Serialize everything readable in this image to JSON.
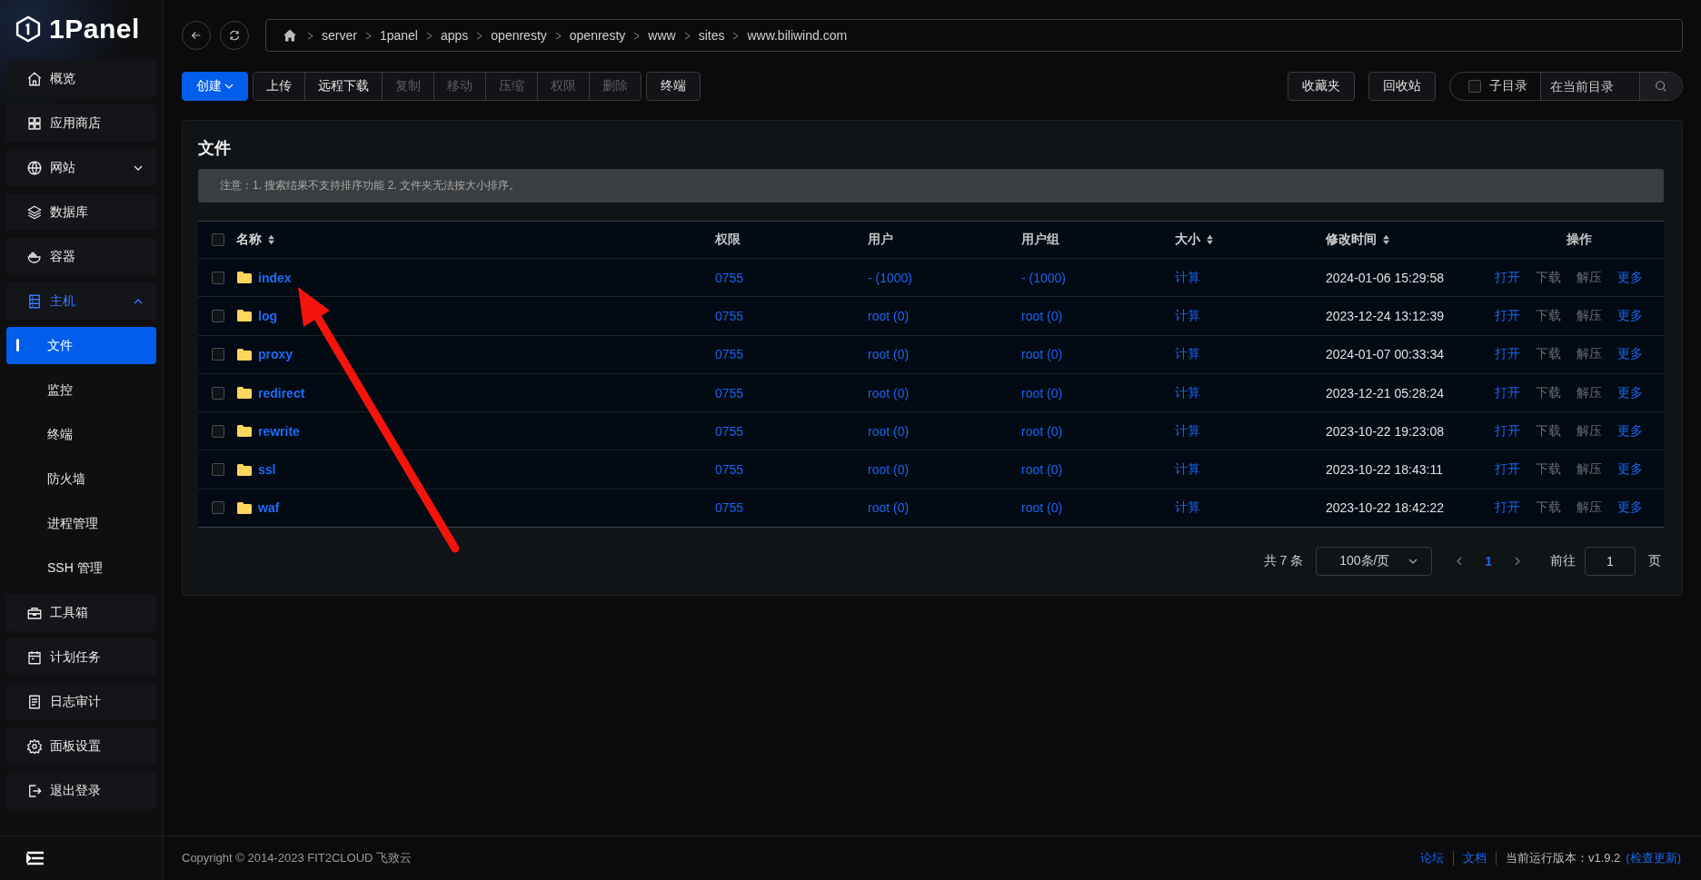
{
  "logo": {
    "text": "1Panel"
  },
  "sidebar": {
    "items": [
      {
        "label": "概览",
        "selected": false
      },
      {
        "label": "应用商店",
        "selected": false
      },
      {
        "label": "网站",
        "selected": false,
        "expanded": false
      },
      {
        "label": "数据库",
        "selected": false
      },
      {
        "label": "容器",
        "selected": false
      },
      {
        "label": "主机",
        "selected": false,
        "expanded": true,
        "children": [
          {
            "label": "文件",
            "selected": true
          },
          {
            "label": "监控",
            "selected": false
          },
          {
            "label": "终端",
            "selected": false
          },
          {
            "label": "防火墙",
            "selected": false
          },
          {
            "label": "进程管理",
            "selected": false
          },
          {
            "label": "SSH 管理",
            "selected": false
          }
        ]
      },
      {
        "label": "工具箱",
        "selected": false
      },
      {
        "label": "计划任务",
        "selected": false
      },
      {
        "label": "日志审计",
        "selected": false
      },
      {
        "label": "面板设置",
        "selected": false
      },
      {
        "label": "退出登录",
        "selected": false
      }
    ]
  },
  "breadcrumb": [
    "server",
    "1panel",
    "apps",
    "openresty",
    "openresty",
    "www",
    "sites",
    "www.biliwind.com"
  ],
  "toolbar": {
    "create": "创建",
    "actions": [
      {
        "label": "上传",
        "disabled": false
      },
      {
        "label": "远程下载",
        "disabled": false
      },
      {
        "label": "复制",
        "disabled": true
      },
      {
        "label": "移动",
        "disabled": true
      },
      {
        "label": "压缩",
        "disabled": true
      },
      {
        "label": "权限",
        "disabled": true
      },
      {
        "label": "删除",
        "disabled": true
      }
    ],
    "terminal": "终端",
    "favorites": "收藏夹",
    "recycle_bin": "回收站",
    "search": {
      "subdir_label": "子目录",
      "subdir_checked": false,
      "placeholder": "在当前目录"
    }
  },
  "card": {
    "title": "文件",
    "notice": "注意：1. 搜索结果不支持排序功能 2. 文件夹无法按大小排序。"
  },
  "table": {
    "all_checked": false,
    "columns": [
      {
        "label": "名称",
        "sortable": true
      },
      {
        "label": "权限",
        "sortable": false
      },
      {
        "label": "用户",
        "sortable": false
      },
      {
        "label": "用户组",
        "sortable": false
      },
      {
        "label": "大小",
        "sortable": true
      },
      {
        "label": "修改时间",
        "sortable": true
      },
      {
        "label": "操作",
        "sortable": false
      }
    ],
    "rows": [
      {
        "checked": false,
        "name": "index",
        "mode": "0755",
        "user": "- (1000)",
        "group": "- (1000)",
        "size": "计算",
        "modified": "2024-01-06 15:29:58",
        "actions": [
          {
            "label": "打开",
            "disabled": false
          },
          {
            "label": "下载",
            "disabled": true
          },
          {
            "label": "解压",
            "disabled": true
          },
          {
            "label": "更多",
            "disabled": false
          }
        ]
      },
      {
        "checked": false,
        "name": "log",
        "mode": "0755",
        "user": "root (0)",
        "group": "root (0)",
        "size": "计算",
        "modified": "2023-12-24 13:12:39",
        "actions": [
          {
            "label": "打开",
            "disabled": false
          },
          {
            "label": "下载",
            "disabled": true
          },
          {
            "label": "解压",
            "disabled": true
          },
          {
            "label": "更多",
            "disabled": false
          }
        ]
      },
      {
        "checked": false,
        "name": "proxy",
        "mode": "0755",
        "user": "root (0)",
        "group": "root (0)",
        "size": "计算",
        "modified": "2024-01-07 00:33:34",
        "actions": [
          {
            "label": "打开",
            "disabled": false
          },
          {
            "label": "下载",
            "disabled": true
          },
          {
            "label": "解压",
            "disabled": true
          },
          {
            "label": "更多",
            "disabled": false
          }
        ]
      },
      {
        "checked": false,
        "name": "redirect",
        "mode": "0755",
        "user": "root (0)",
        "group": "root (0)",
        "size": "计算",
        "modified": "2023-12-21 05:28:24",
        "actions": [
          {
            "label": "打开",
            "disabled": false
          },
          {
            "label": "下载",
            "disabled": true
          },
          {
            "label": "解压",
            "disabled": true
          },
          {
            "label": "更多",
            "disabled": false
          }
        ]
      },
      {
        "checked": false,
        "name": "rewrite",
        "mode": "0755",
        "user": "root (0)",
        "group": "root (0)",
        "size": "计算",
        "modified": "2023-10-22 19:23:08",
        "actions": [
          {
            "label": "打开",
            "disabled": false
          },
          {
            "label": "下载",
            "disabled": true
          },
          {
            "label": "解压",
            "disabled": true
          },
          {
            "label": "更多",
            "disabled": false
          }
        ]
      },
      {
        "checked": false,
        "name": "ssl",
        "mode": "0755",
        "user": "root (0)",
        "group": "root (0)",
        "size": "计算",
        "modified": "2023-10-22 18:43:11",
        "actions": [
          {
            "label": "打开",
            "disabled": false
          },
          {
            "label": "下载",
            "disabled": true
          },
          {
            "label": "解压",
            "disabled": true
          },
          {
            "label": "更多",
            "disabled": false
          }
        ]
      },
      {
        "checked": false,
        "name": "waf",
        "mode": "0755",
        "user": "root (0)",
        "group": "root (0)",
        "size": "计算",
        "modified": "2023-10-22 18:42:22",
        "actions": [
          {
            "label": "打开",
            "disabled": false
          },
          {
            "label": "下载",
            "disabled": true
          },
          {
            "label": "解压",
            "disabled": true
          },
          {
            "label": "更多",
            "disabled": false
          }
        ]
      }
    ]
  },
  "pagination": {
    "total": "共 7 条",
    "page_size": "100条/页",
    "pages": [
      {
        "label": "1",
        "selected": true
      }
    ],
    "goto_label": "前往",
    "goto_value": "1",
    "goto_suffix": "页"
  },
  "footer": {
    "copyright": "Copyright © 2014-2023 FIT2CLOUD 飞致云",
    "links": [
      "论坛",
      "文档"
    ],
    "version": "当前运行版本：v1.9.2",
    "update_link": "(检查更新)"
  }
}
